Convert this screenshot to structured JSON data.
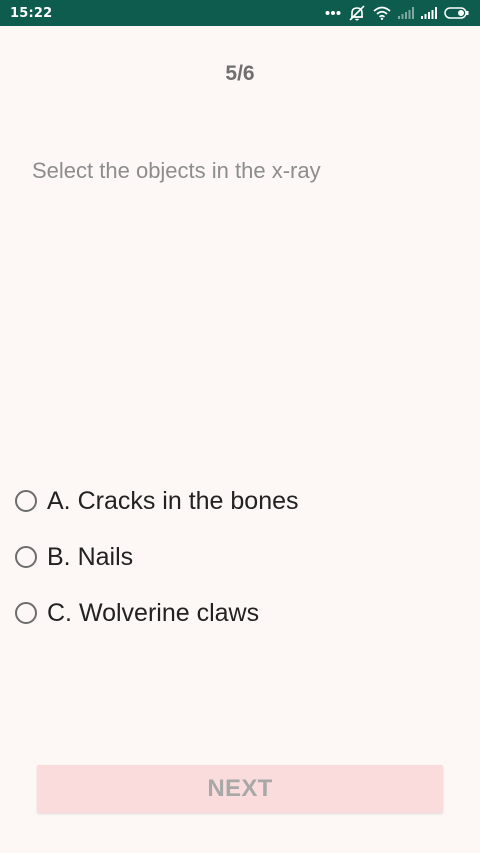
{
  "status_bar": {
    "time": "15:22",
    "icons": [
      "more-dots-icon",
      "alarm-off-icon",
      "wifi-icon",
      "signal-weak-icon",
      "signal-strong-icon",
      "battery-icon"
    ],
    "color": "#0d5c4e"
  },
  "quiz": {
    "progress": "5/6",
    "question": "Select the objects in the x-ray",
    "options": [
      {
        "label": "A. Cracks in the bones"
      },
      {
        "label": "B. Nails"
      },
      {
        "label": "C. Wolverine claws"
      }
    ],
    "next_label": "NEXT"
  },
  "colors": {
    "background": "#fdf7f6",
    "button_disabled": "#fadcdc"
  }
}
